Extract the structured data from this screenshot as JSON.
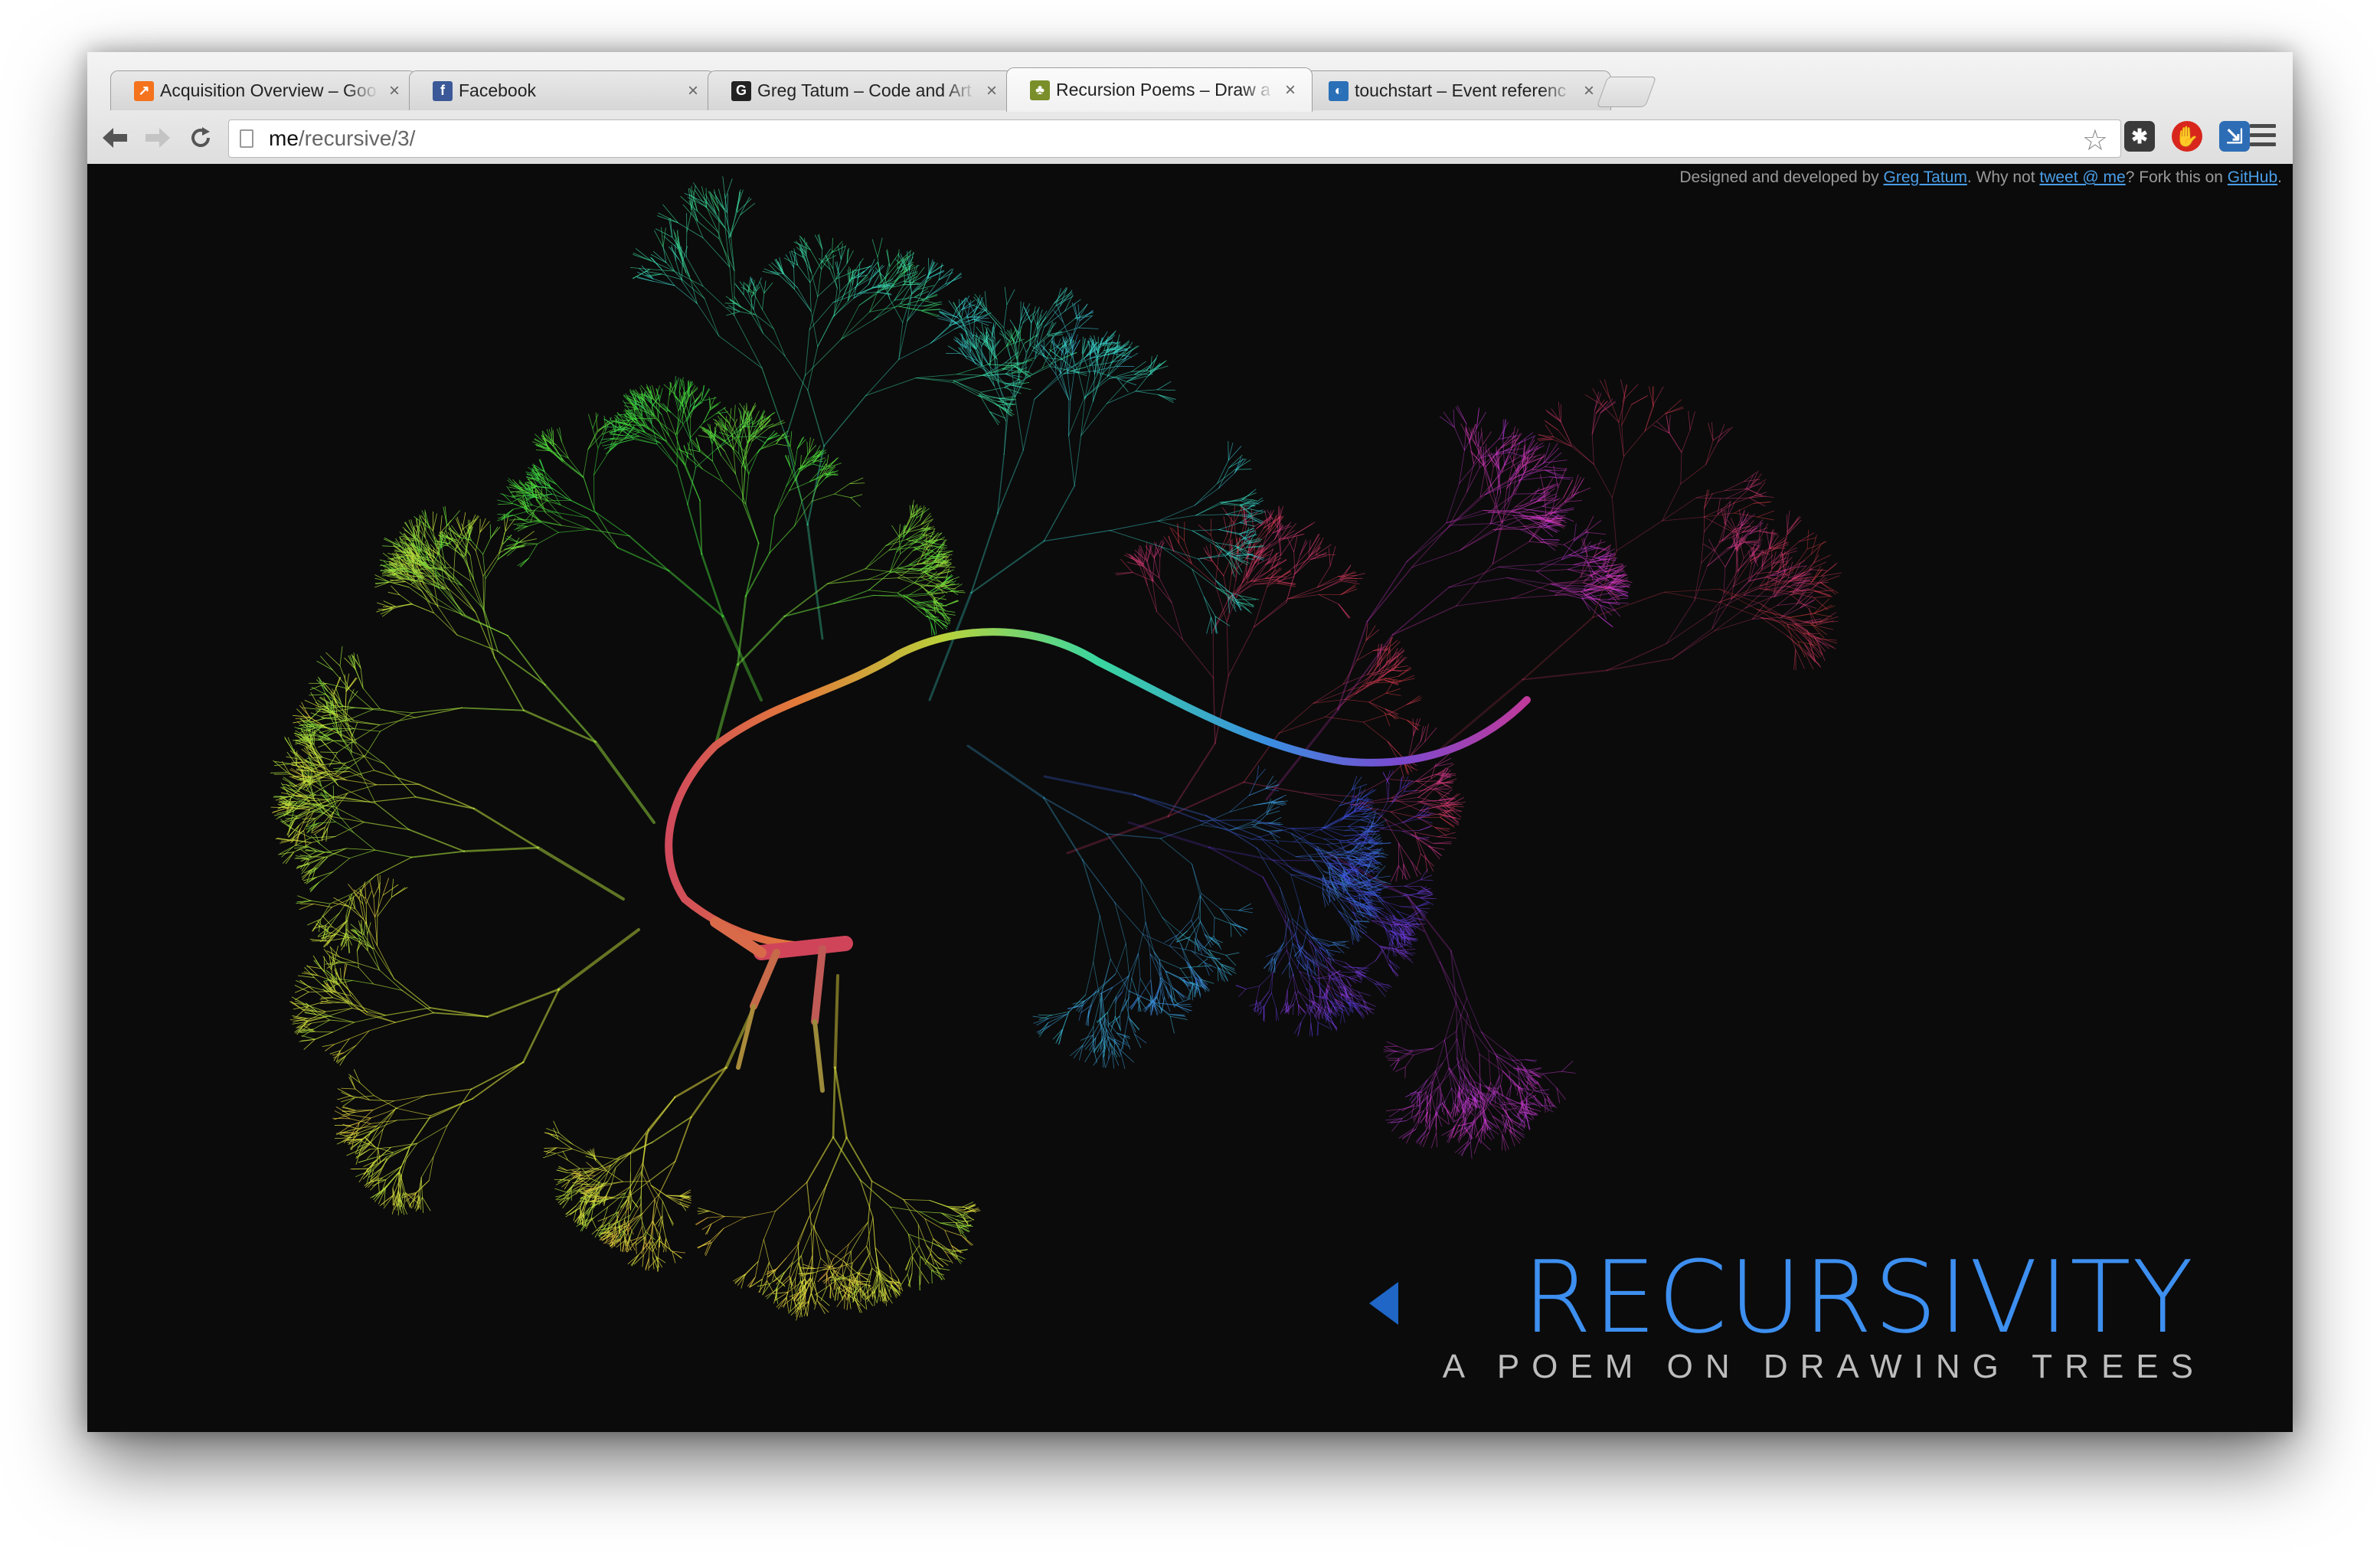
{
  "browser": {
    "tabs": [
      {
        "title": "Acquisition Overview – Goo",
        "favicon": "analytics-icon",
        "active": false
      },
      {
        "title": "Facebook",
        "favicon": "facebook-icon",
        "active": false
      },
      {
        "title": "Greg Tatum – Code and Art",
        "favicon": "g-logo-icon",
        "active": false
      },
      {
        "title": "Recursion Poems – Draw a",
        "favicon": "tree-icon",
        "active": true
      },
      {
        "title": "touchstart – Event referenc",
        "favicon": "mdn-icon",
        "active": false
      }
    ],
    "close_glyph": "×",
    "url": {
      "host": "me",
      "path": "/recursive/3/"
    }
  },
  "credits": {
    "prefix": "Designed and developed by ",
    "author_link": "Greg Tatum",
    "middle": ". Why not ",
    "tweet_link": "tweet @ me",
    "fork": "? Fork this on ",
    "github_link": "GitHub",
    "end": "."
  },
  "branding": {
    "title": "RECURSIVITY",
    "subtitle": "A POEM ON DRAWING TREES"
  },
  "colors": {
    "background": "#0b0b0b",
    "title": "#3d8ff0",
    "subtitle": "#bdbdbd",
    "link": "#4a9ee8"
  }
}
